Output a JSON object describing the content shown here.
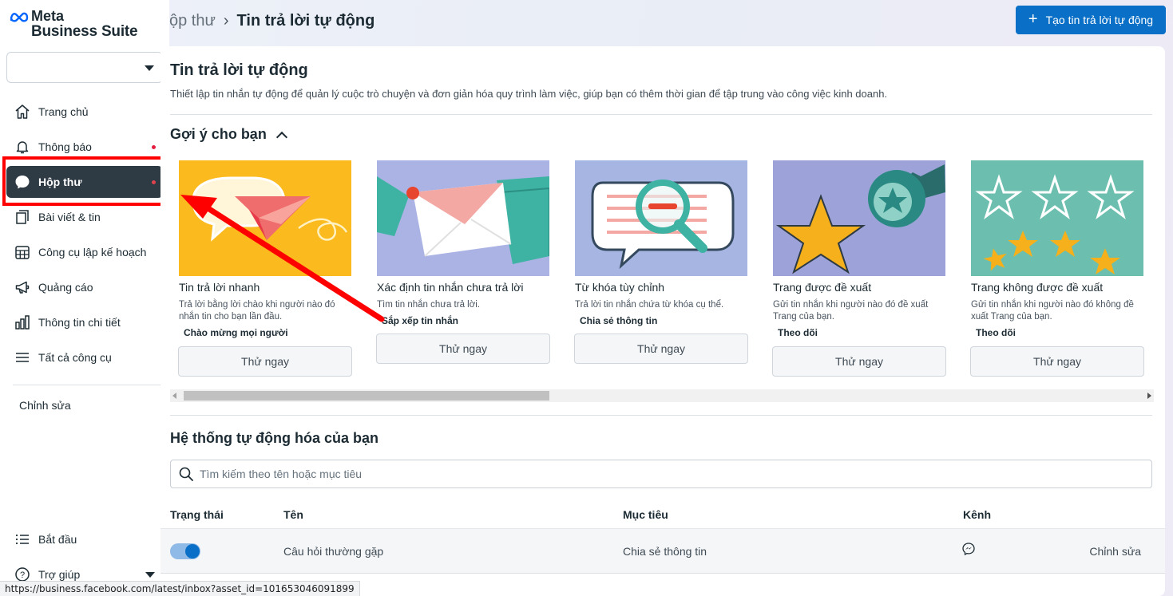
{
  "brand": {
    "meta": "Meta",
    "suite": "Business Suite"
  },
  "sidebar": {
    "items": [
      {
        "label": "Trang chủ",
        "icon": "home-icon"
      },
      {
        "label": "Thông báo",
        "icon": "bell-icon",
        "dot": true
      },
      {
        "label": "Hộp thư",
        "icon": "chat-bubble-icon",
        "dot": true,
        "active": true
      },
      {
        "label": "Bài viết & tin",
        "icon": "posts-icon"
      },
      {
        "label": "Công cụ lập kế hoạch",
        "icon": "calendar-icon"
      },
      {
        "label": "Quảng cáo",
        "icon": "megaphone-icon"
      },
      {
        "label": "Thông tin chi tiết",
        "icon": "bar-chart-icon"
      },
      {
        "label": "Tất cả công cụ",
        "icon": "menu-icon"
      }
    ],
    "edit_label": "Chỉnh sửa",
    "bottom": [
      {
        "label": "Bắt đầu",
        "icon": "list-icon"
      },
      {
        "label": "Trợ giúp",
        "icon": "help-icon"
      }
    ]
  },
  "header": {
    "breadcrumb_prev": "ộp thư",
    "breadcrumb_current": "Tin trả lời tự động",
    "create_button": "Tạo tin trả lời tự động"
  },
  "main": {
    "title": "Tin trả lời tự động",
    "description": "Thiết lập tin nhắn tự động để quản lý cuộc trò chuyện và đơn giản hóa quy trình làm việc, giúp bạn có thêm thời gian để tập trung vào công việc kinh doanh.",
    "suggestions_title": "Gợi ý cho bạn",
    "cards": [
      {
        "title": "Tin trả lời nhanh",
        "desc": "Trả lời bằng lời chào khi người nào đó nhắn tin cho bạn lần đầu.",
        "tag": "Chào mừng mọi người",
        "button": "Thử ngay"
      },
      {
        "title": "Xác định tin nhắn chưa trả lời",
        "desc": "Tìm tin nhắn chưa trả lời.",
        "tag": "Sắp xếp tin nhắn",
        "button": "Thử ngay"
      },
      {
        "title": "Từ khóa tùy chỉnh",
        "desc": "Trả lời tin nhắn chứa từ khóa cụ thể.",
        "tag": "Chia sẻ thông tin",
        "button": "Thử ngay"
      },
      {
        "title": "Trang được đề xuất",
        "desc": "Gửi tin nhắn khi người nào đó đề xuất Trang của bạn.",
        "tag": "Theo dõi",
        "button": "Thử ngay"
      },
      {
        "title": "Trang không được đề xuất",
        "desc": "Gửi tin nhắn khi người nào đó không đề xuất Trang của bạn.",
        "tag": "Theo dõi",
        "button": "Thử ngay"
      }
    ],
    "automations_title": "Hệ thống tự động hóa của bạn",
    "search_placeholder": "Tìm kiếm theo tên hoặc mục tiêu",
    "table": {
      "headers": [
        "Trạng thái",
        "Tên",
        "Mục tiêu",
        "Kênh"
      ],
      "rows": [
        {
          "status_on": true,
          "name": "Câu hỏi thường gặp",
          "goal": "Chia sẻ thông tin",
          "channel_icon": "messenger-icon",
          "action": "Chỉnh sửa"
        }
      ]
    }
  },
  "status_bar": {
    "url": "https://business.facebook.com/latest/inbox?asset_id=101653046091899"
  },
  "colors": {
    "accent": "#0a6fc6",
    "active_nav": "#2e3a44",
    "annotation": "#ff0000"
  }
}
